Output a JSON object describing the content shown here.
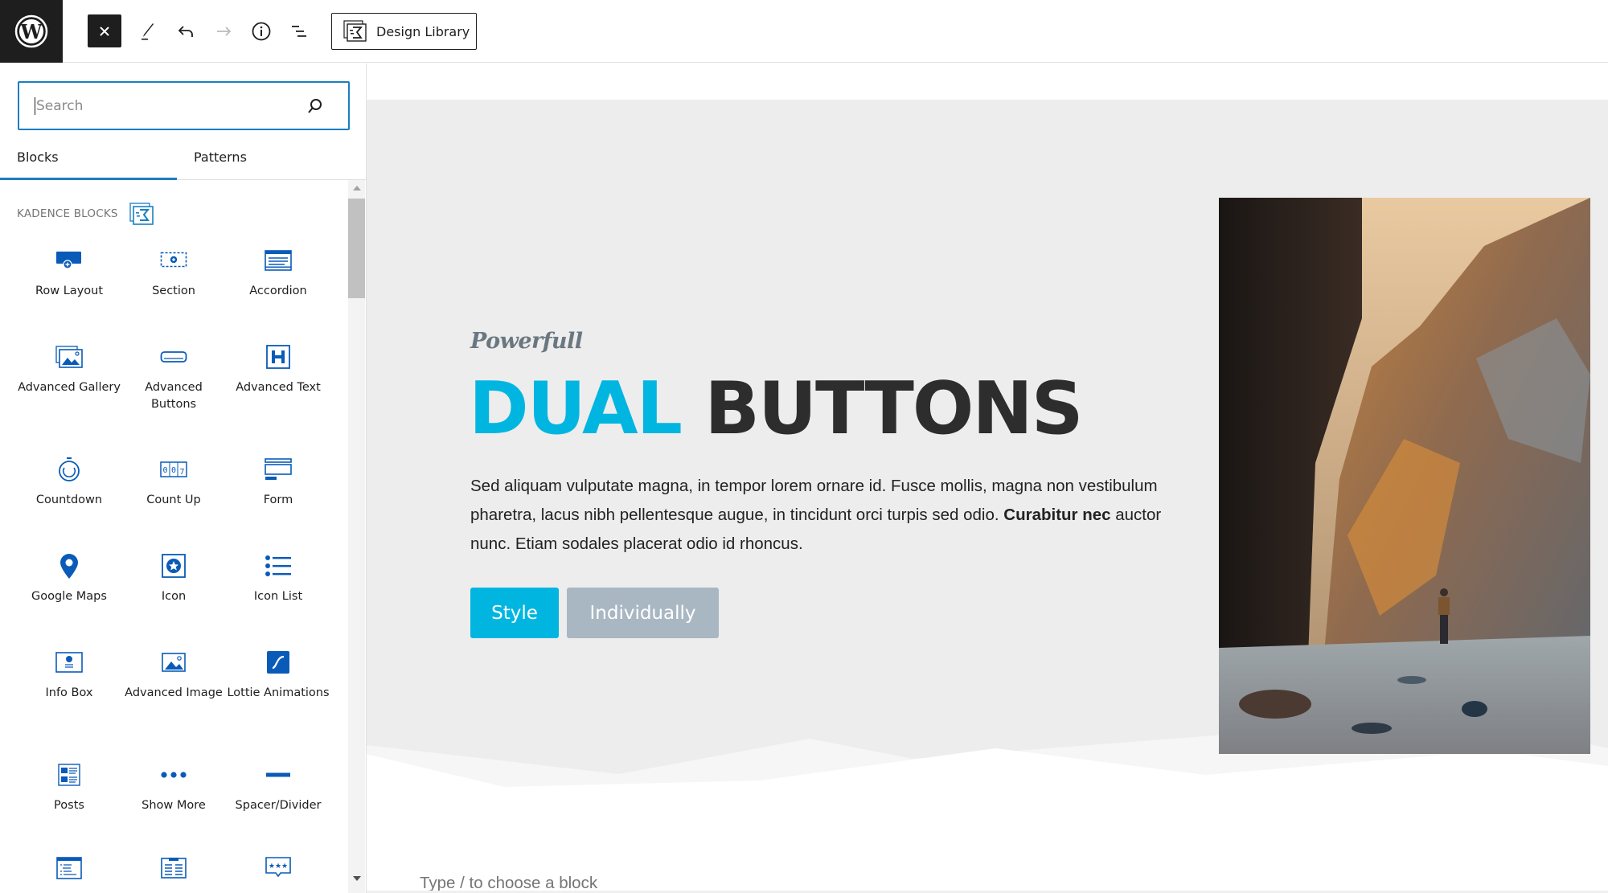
{
  "toolbar": {
    "logo": "wordpress-logo",
    "close_icon": "close-icon",
    "tools_icon": "pencil-icon",
    "undo_icon": "undo-icon",
    "redo_icon": "redo-icon",
    "details_icon": "info-icon",
    "outline_icon": "list-view-icon",
    "design_library_label": "Design Library"
  },
  "inserter": {
    "search_placeholder": "Search",
    "search_value": "",
    "tabs": [
      {
        "label": "Blocks",
        "active": true
      },
      {
        "label": "Patterns",
        "active": false
      }
    ],
    "category_label": "KADENCE BLOCKS",
    "blocks": [
      {
        "label": "Row Layout",
        "icon": "row-layout-icon"
      },
      {
        "label": "Section",
        "icon": "section-icon"
      },
      {
        "label": "Accordion",
        "icon": "accordion-icon"
      },
      {
        "label": "Advanced Gallery",
        "icon": "gallery-icon"
      },
      {
        "label": "Advanced Buttons",
        "icon": "buttons-icon"
      },
      {
        "label": "Advanced Text",
        "icon": "heading-icon"
      },
      {
        "label": "Countdown",
        "icon": "countdown-icon"
      },
      {
        "label": "Count Up",
        "icon": "count-up-icon"
      },
      {
        "label": "Form",
        "icon": "form-icon"
      },
      {
        "label": "Google Maps",
        "icon": "map-pin-icon"
      },
      {
        "label": "Icon",
        "icon": "star-icon"
      },
      {
        "label": "Icon List",
        "icon": "icon-list-icon"
      },
      {
        "label": "Info Box",
        "icon": "info-box-icon"
      },
      {
        "label": "Advanced Image",
        "icon": "image-icon"
      },
      {
        "label": "Lottie Animations",
        "icon": "lottie-icon"
      },
      {
        "label": "Posts",
        "icon": "posts-icon"
      },
      {
        "label": "Show More",
        "icon": "show-more-icon"
      },
      {
        "label": "Spacer/Divider",
        "icon": "spacer-icon"
      },
      {
        "label": "",
        "icon": "table-of-contents-icon"
      },
      {
        "label": "",
        "icon": "portfolio-grid-icon"
      },
      {
        "label": "",
        "icon": "testimonials-icon"
      }
    ]
  },
  "canvas": {
    "eyebrow": "Powerfull",
    "headline_accent": "DUAL",
    "headline_rest": "BUTTONS",
    "paragraph_before_bold": "Sed aliquam vulputate magna, in tempor lorem ornare id. Fusce mollis, magna non vestibulum pharetra, lacus nibh pellentesque augue, in tincidunt orci turpis sed odio. ",
    "paragraph_bold": "Curabitur nec",
    "paragraph_after_bold": " auctor nunc. Etiam sodales placerat odio id rhoncus.",
    "buttons": [
      {
        "label": "Style"
      },
      {
        "label": "Individually"
      }
    ],
    "image_alt": "hiker walking through a narrow river canyon",
    "appender_placeholder": "Type / to choose a block"
  },
  "colors": {
    "accent": "#00b6e1",
    "secondary_button": "#a9b7c3",
    "headline_dark": "#2d2d2d",
    "editor_blue": "#1b7ec2",
    "icon_blue": "#0a5bb8"
  }
}
